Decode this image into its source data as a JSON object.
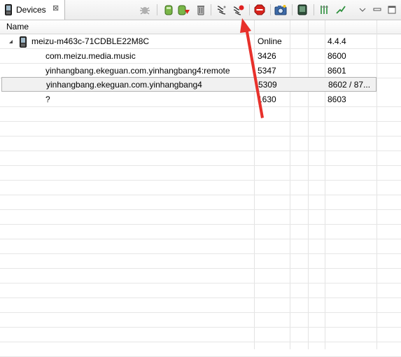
{
  "tab": {
    "title": "Devices",
    "close_glyph": "⊠"
  },
  "toolbar": {
    "icons": [
      "debug-icon",
      "update-heap-icon",
      "dump-hprof-icon",
      "cause-gc-icon",
      "update-threads-icon",
      "start-method-profiling-icon",
      "stop-process-icon",
      "screen-capture-icon",
      "dump-view-hierarchy-icon",
      "systrace-icon",
      "opengl-trace-icon",
      "view-menu-icon",
      "minimize-icon",
      "maximize-icon"
    ]
  },
  "columns": {
    "name": "Name"
  },
  "device": {
    "name": "meizu-m463c-71CDBLE22M8C",
    "status": "Online",
    "version": "4.4.4"
  },
  "processes": [
    {
      "name": "com.meizu.media.music",
      "pid": "3426",
      "port": "8600"
    },
    {
      "name": "yinhangbang.ekeguan.com.yinhangbang4:remote",
      "pid": "5347",
      "port": "8601"
    },
    {
      "name": "yinhangbang.ekeguan.com.yinhangbang4",
      "pid": "5309",
      "port": "8602 / 87..."
    },
    {
      "name": "?",
      "pid": "1630",
      "port": "8603"
    }
  ],
  "annotation": {
    "color": "#e8312b"
  }
}
